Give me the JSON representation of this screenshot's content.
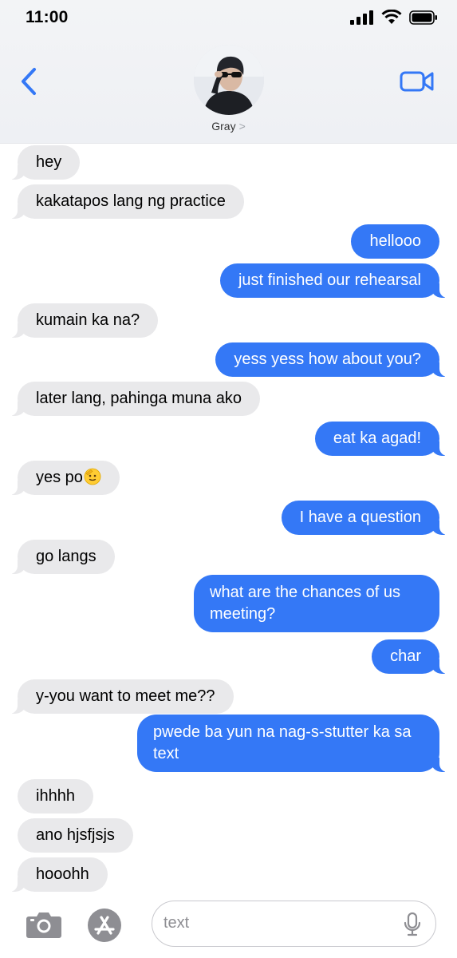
{
  "status_bar": {
    "time": "11:00"
  },
  "header": {
    "contact_name": "Gray",
    "name_chevron": ">"
  },
  "messages": [
    {
      "dir": "in",
      "text": "hey"
    },
    {
      "dir": "in",
      "text": "kakatapos lang ng practice"
    },
    {
      "dir": "out",
      "text": "hellooo"
    },
    {
      "dir": "out",
      "text": "just finished our rehearsal"
    },
    {
      "dir": "in",
      "text": "kumain ka na?"
    },
    {
      "dir": "out",
      "text": "yess yess how about you?"
    },
    {
      "dir": "in",
      "text": "later lang, pahinga muna ako"
    },
    {
      "dir": "out",
      "text": "eat ka agad!"
    },
    {
      "dir": "in",
      "text": "yes po"
    },
    {
      "dir": "out",
      "text": "I have a question"
    },
    {
      "dir": "in",
      "text": "go langs"
    },
    {
      "dir": "out",
      "text": "what are the chances of us meeting?"
    },
    {
      "dir": "out",
      "text": "char"
    },
    {
      "dir": "in",
      "text": "y-you want to meet me??"
    },
    {
      "dir": "out",
      "text": "pwede ba yun na nag-s-stutter ka sa text"
    },
    {
      "dir": "in",
      "text": "ihhhh"
    },
    {
      "dir": "in",
      "text": "ano hjsfjsjs"
    },
    {
      "dir": "in",
      "text": "hooohh"
    }
  ],
  "composer": {
    "placeholder": "text"
  },
  "icons": {
    "back": "chevron-left-icon",
    "video": "video-camera-icon",
    "camera": "camera-icon",
    "appstore": "app-store-icon",
    "mic": "microphone-icon",
    "emoji": "saluting-face-emoji"
  },
  "colors": {
    "accent": "#3478f6",
    "incoming_bubble": "#e9e9eb",
    "outgoing_bubble": "#3478f6"
  }
}
